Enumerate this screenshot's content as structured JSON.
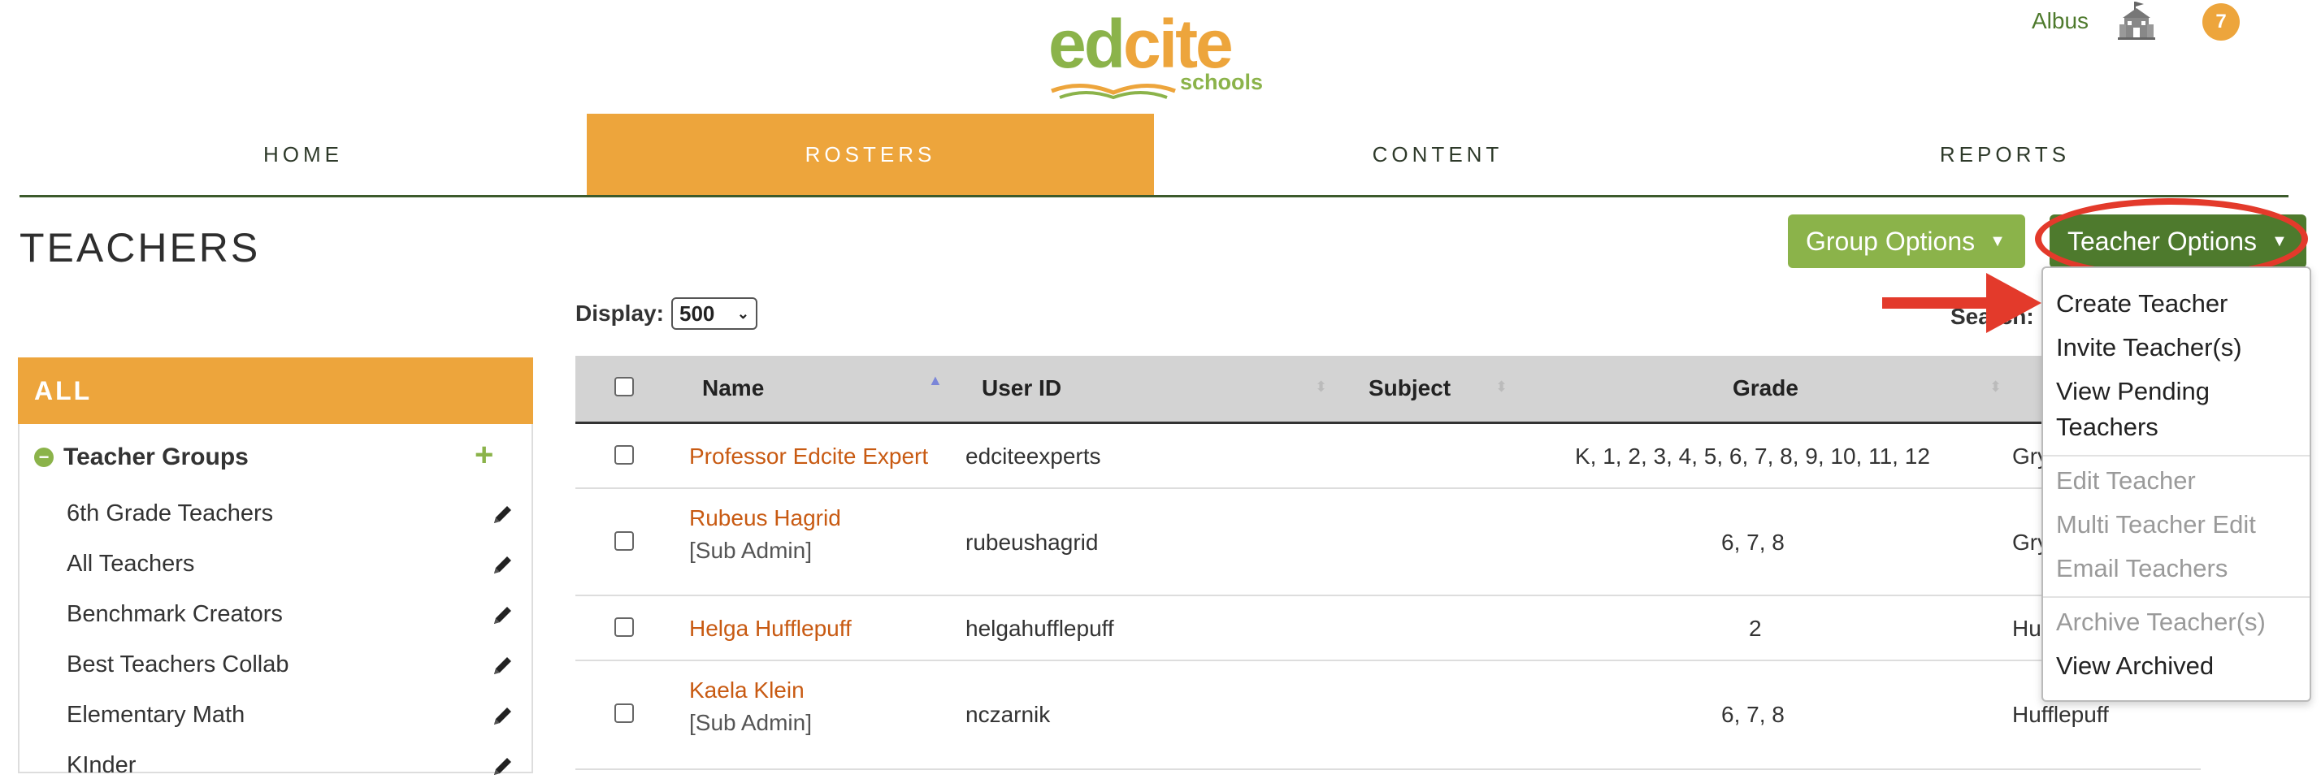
{
  "header": {
    "logo": {
      "part1": "ed",
      "part2": "cite",
      "sub": "schools"
    },
    "user_name": "Albus",
    "school_icon": "school-building-icon",
    "notification_count": "7"
  },
  "nav": {
    "items": [
      {
        "label": "HOME"
      },
      {
        "label": "ROSTERS",
        "active": true
      },
      {
        "label": "CONTENT"
      },
      {
        "label": "REPORTS"
      }
    ]
  },
  "page": {
    "title": "TEACHERS"
  },
  "toolbar": {
    "group_options": "Group Options",
    "teacher_options": "Teacher Options",
    "display_label": "Display:",
    "display_value": "500",
    "search_label": "Search:"
  },
  "sidebar": {
    "all_label": "ALL",
    "groups_title": "Teacher Groups",
    "items": [
      {
        "label": "6th Grade Teachers"
      },
      {
        "label": "All Teachers"
      },
      {
        "label": "Benchmark Creators"
      },
      {
        "label": "Best Teachers Collab"
      },
      {
        "label": "Elementary Math"
      },
      {
        "label": "KInder"
      }
    ]
  },
  "table": {
    "headers": {
      "name": "Name",
      "user_id": "User ID",
      "subject": "Subject",
      "grade": "Grade"
    },
    "rows": [
      {
        "name": "Professor Edcite Expert",
        "role": "",
        "user_id": "edciteexperts",
        "subject": "",
        "grade": "K, 1, 2, 3, 4, 5, 6, 7, 8, 9, 10, 11, 12",
        "group": "Gry"
      },
      {
        "name": "Rubeus Hagrid",
        "role": "[Sub Admin]",
        "user_id": "rubeushagrid",
        "subject": "",
        "grade": "6, 7, 8",
        "group": "Gry"
      },
      {
        "name": "Helga Hufflepuff",
        "role": "",
        "user_id": "helgahufflepuff",
        "subject": "",
        "grade": "2",
        "group": "Hu"
      },
      {
        "name": "Kaela Klein",
        "role": "[Sub Admin]",
        "user_id": "nczarnik",
        "subject": "",
        "grade": "6, 7, 8",
        "group": "Hufflepuff"
      }
    ]
  },
  "dropdown": {
    "items": [
      {
        "label": "Create Teacher",
        "enabled": true
      },
      {
        "label": "Invite Teacher(s)",
        "enabled": true
      },
      {
        "label": "View Pending",
        "enabled": true
      },
      {
        "label": "Teachers",
        "enabled": true
      },
      {
        "label": "Edit Teacher",
        "enabled": false
      },
      {
        "label": "Multi Teacher Edit",
        "enabled": false
      },
      {
        "label": "Email Teachers",
        "enabled": false
      },
      {
        "label": "Archive Teacher(s)",
        "enabled": false
      },
      {
        "label": "View Archived",
        "enabled": true
      }
    ]
  },
  "colors": {
    "brand_green": "#8bb34a",
    "dark_green": "#4e7a2d",
    "brand_orange": "#eda53c",
    "link_orange": "#c85a12",
    "annotation_red": "#e33a2b"
  }
}
